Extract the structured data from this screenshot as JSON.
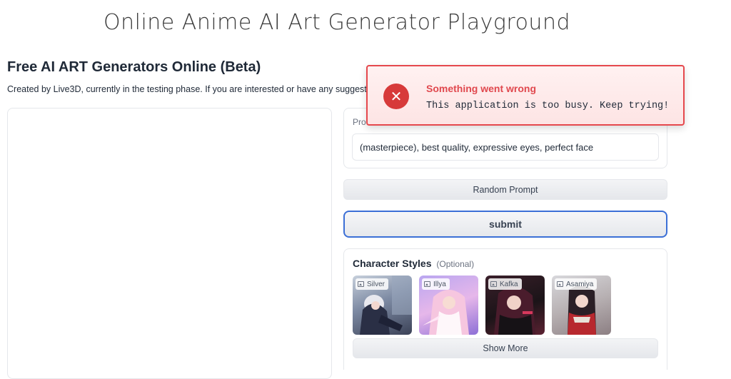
{
  "page": {
    "title": "Online Anime AI Art Generator Playground",
    "section_title": "Free AI ART Generators Online (Beta)",
    "description": "Created by Live3D, currently in the testing phase. If you are interested or have any suggestion"
  },
  "prompt": {
    "label": "Pro",
    "value": "(masterpiece), best quality, expressive eyes, perfect face"
  },
  "buttons": {
    "random_prompt": "Random Prompt",
    "submit": "submit",
    "show_more": "Show More"
  },
  "character_styles": {
    "title": "Character Styles",
    "optional": "(Optional)",
    "items": [
      {
        "name": "Silver",
        "icon": "image-icon"
      },
      {
        "name": "Illya",
        "icon": "image-icon"
      },
      {
        "name": "Kafka",
        "icon": "image-icon"
      },
      {
        "name": "Asamiya",
        "icon": "image-icon"
      }
    ]
  },
  "toast": {
    "title": "Something went wrong",
    "message": "This application is too busy. Keep trying!",
    "icon": "close-circle-icon"
  },
  "colors": {
    "error": "#e5484d",
    "submit_border": "#3b6fd6"
  }
}
